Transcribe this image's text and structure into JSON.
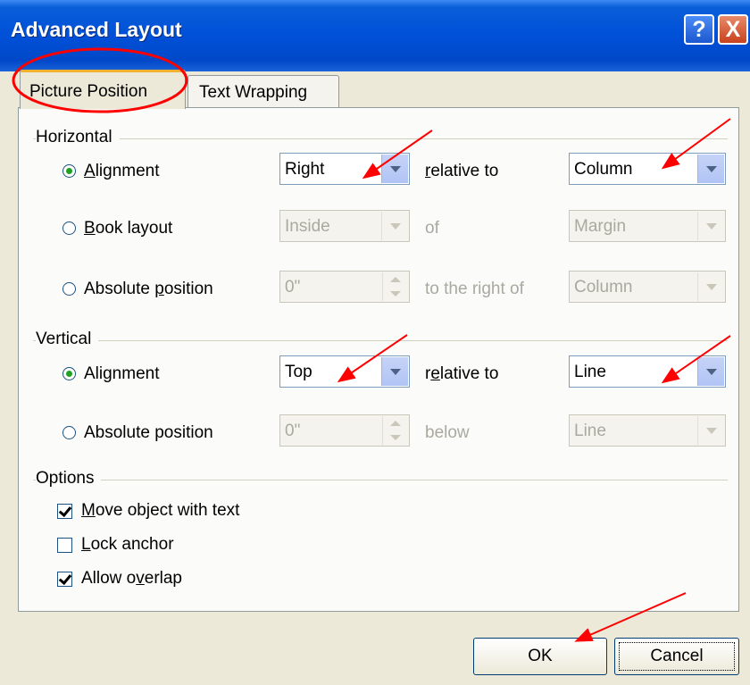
{
  "window": {
    "title": "Advanced Layout",
    "help_icon": "?",
    "close_icon": "X"
  },
  "tabs": [
    {
      "label": "Picture Position",
      "selected": true
    },
    {
      "label": "Text Wrapping",
      "selected": false
    }
  ],
  "horizontal": {
    "group_label": "Horizontal",
    "rows": [
      {
        "option": "Alignment",
        "selected": true,
        "value": "Right",
        "mid": "relative to",
        "target": "Column",
        "enabled": true
      },
      {
        "option": "Book layout",
        "selected": false,
        "value": "Inside",
        "mid": "of",
        "target": "Margin",
        "enabled": false
      },
      {
        "option": "Absolute position",
        "selected": false,
        "value": "0\"",
        "mid": "to the right of",
        "target": "Column",
        "enabled": false
      }
    ]
  },
  "vertical": {
    "group_label": "Vertical",
    "rows": [
      {
        "option": "Alignment",
        "selected": true,
        "value": "Top",
        "mid": "relative to",
        "target": "Line",
        "enabled": true
      },
      {
        "option": "Absolute position",
        "selected": false,
        "value": "0\"",
        "mid": "below",
        "target": "Line",
        "enabled": false
      }
    ]
  },
  "options": {
    "group_label": "Options",
    "items": [
      {
        "label": "Move object with text",
        "checked": true
      },
      {
        "label": "Lock anchor",
        "checked": false
      },
      {
        "label": "Allow overlap",
        "checked": true
      }
    ]
  },
  "buttons": {
    "ok": "OK",
    "cancel": "Cancel"
  },
  "colors": {
    "title_bar": "#0050d8",
    "annotation": "#ff0000",
    "selected_radio": "#21a121"
  }
}
